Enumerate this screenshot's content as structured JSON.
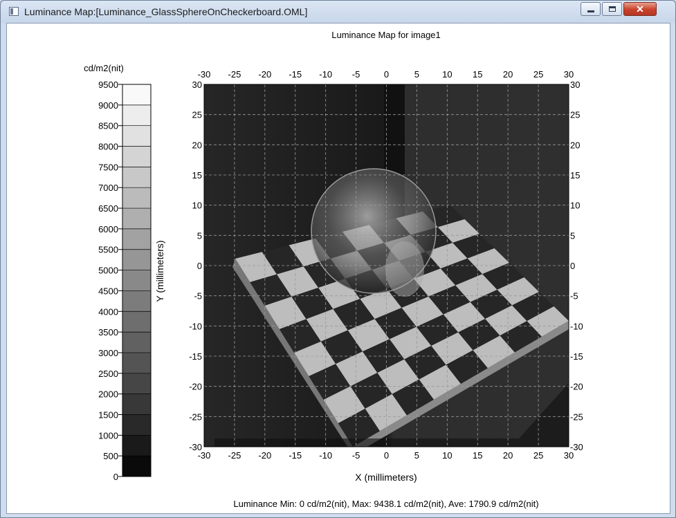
{
  "window": {
    "title": "Luminance Map:[Luminance_GlassSphereOnCheckerboard.OML]",
    "icons": {
      "app": "app-window-icon",
      "minimize": "minimize-icon",
      "maximize": "maximize-icon",
      "close": "close-icon"
    },
    "close_glyph": "✕"
  },
  "plot": {
    "title": "Luminance Map for image1",
    "x_label": "X (millimeters)",
    "y_label": "Y (millimeters)",
    "x_ticks": [
      "-30",
      "-25",
      "-20",
      "-15",
      "-10",
      "-5",
      "0",
      "5",
      "10",
      "15",
      "20",
      "25",
      "30"
    ],
    "y_ticks": [
      "30",
      "25",
      "20",
      "15",
      "10",
      "5",
      "0",
      "-5",
      "-10",
      "-15",
      "-20",
      "-25",
      "-30"
    ],
    "grid": true
  },
  "colorbar": {
    "unit": "cd/m2(nit)",
    "ticks": [
      "9500",
      "9000",
      "8500",
      "8000",
      "7500",
      "7000",
      "6500",
      "6000",
      "5500",
      "5000",
      "4500",
      "4000",
      "3500",
      "3000",
      "2500",
      "2000",
      "1500",
      "1000",
      "500",
      "0"
    ],
    "min": 0,
    "max": 9500
  },
  "stats": {
    "text": "Luminance Min: 0 cd/m2(nit), Max: 9438.1 cd/m2(nit), Ave: 1790.9 cd/m2(nit)"
  },
  "colors": {
    "window_frame": "#cfdced",
    "close_button": "#c8412c"
  }
}
